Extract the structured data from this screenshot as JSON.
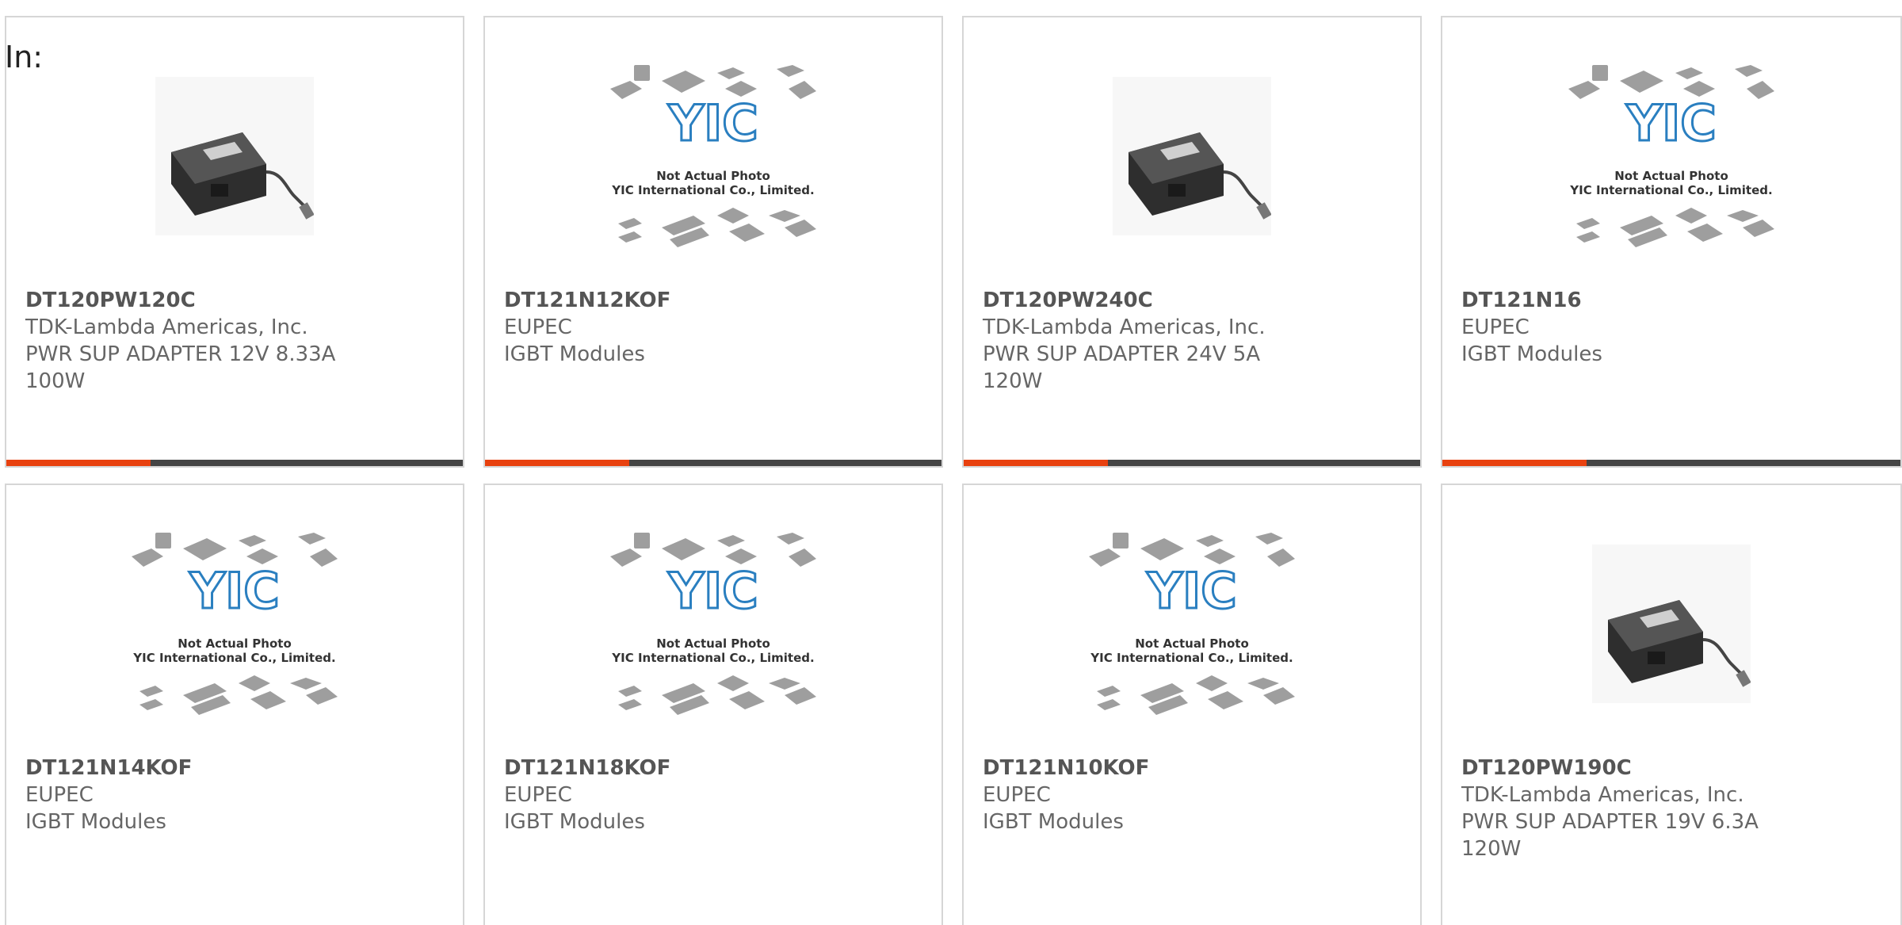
{
  "filter_label": "In:",
  "accent_color": "#e8410f",
  "cards": [
    {
      "part_number": "DT120PW120C",
      "manufacturer": "TDK-Lambda Americas, Inc.",
      "description": "PWR SUP ADAPTER 12V 8.33A 100W",
      "image": "power-adapter-photo"
    },
    {
      "part_number": "DT121N12KOF",
      "manufacturer": "EUPEC",
      "description": "IGBT Modules",
      "image": "not-actual-photo-placeholder",
      "placeholder_line1": "Not Actual Photo",
      "placeholder_line2": "YIC International Co., Limited."
    },
    {
      "part_number": "DT120PW240C",
      "manufacturer": "TDK-Lambda Americas, Inc.",
      "description": "PWR SUP ADAPTER 24V 5A 120W",
      "image": "power-adapter-photo"
    },
    {
      "part_number": "DT121N16",
      "manufacturer": "EUPEC",
      "description": "IGBT Modules",
      "image": "not-actual-photo-placeholder",
      "placeholder_line1": "Not Actual Photo",
      "placeholder_line2": "YIC International Co., Limited."
    },
    {
      "part_number": "DT121N14KOF",
      "manufacturer": "EUPEC",
      "description": "IGBT Modules",
      "image": "not-actual-photo-placeholder",
      "placeholder_line1": "Not Actual Photo",
      "placeholder_line2": "YIC International Co., Limited."
    },
    {
      "part_number": "DT121N18KOF",
      "manufacturer": "EUPEC",
      "description": "IGBT Modules",
      "image": "not-actual-photo-placeholder",
      "placeholder_line1": "Not Actual Photo",
      "placeholder_line2": "YIC International Co., Limited."
    },
    {
      "part_number": "DT121N10KOF",
      "manufacturer": "EUPEC",
      "description": "IGBT Modules",
      "image": "not-actual-photo-placeholder",
      "placeholder_line1": "Not Actual Photo",
      "placeholder_line2": "YIC International Co., Limited."
    },
    {
      "part_number": "DT120PW190C",
      "manufacturer": "TDK-Lambda Americas, Inc.",
      "description": "PWR SUP ADAPTER 19V 6.3A 120W",
      "image": "power-adapter-photo"
    }
  ]
}
